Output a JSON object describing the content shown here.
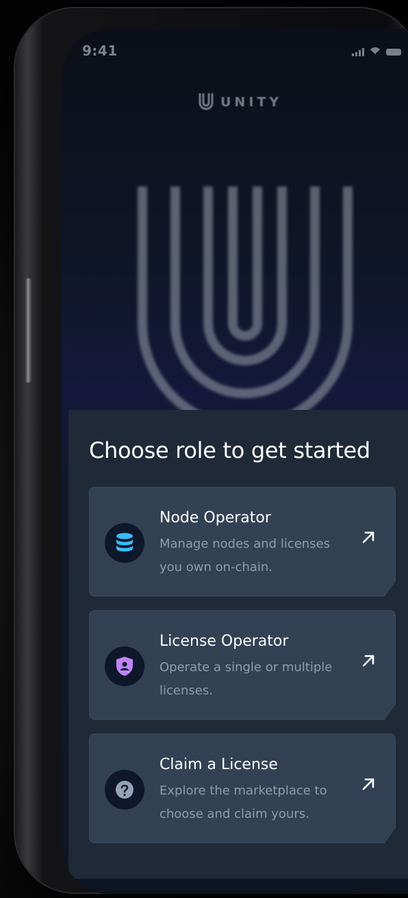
{
  "status_bar": {
    "time": "9:41"
  },
  "brand": {
    "name": "UNITY"
  },
  "sheet": {
    "title": "Choose role to get started",
    "roles": [
      {
        "title": "Node Operator",
        "description": "Manage nodes and licenses you own on-chain.",
        "icon": "database-icon",
        "icon_color": "#38bdf8"
      },
      {
        "title": "License Operator",
        "description": "Operate a single or multiple licenses.",
        "icon": "shield-user-icon",
        "icon_color": "#c084fc"
      },
      {
        "title": "Claim a License",
        "description": "Explore the marketplace to choose and claim yours.",
        "icon": "question-icon",
        "icon_color": "#94a3b8"
      }
    ]
  },
  "colors": {
    "sheet_bg": "#1f2937",
    "card_bg": "#334155",
    "icon_circle_bg": "#0f172a",
    "text_primary": "#ffffff",
    "text_secondary": "#8f9bb0"
  }
}
